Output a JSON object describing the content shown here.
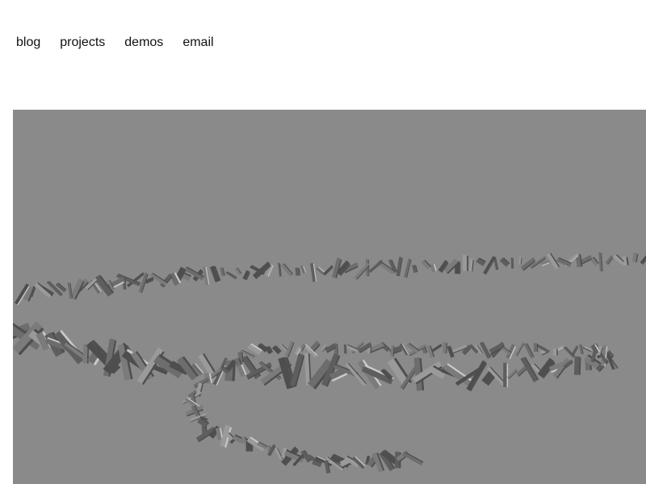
{
  "nav": {
    "items": [
      {
        "label": "blog"
      },
      {
        "label": "projects"
      },
      {
        "label": "demos"
      },
      {
        "label": "email"
      }
    ]
  },
  "scene": {
    "background_color": "#8a8a8a",
    "slab_colors": [
      "#5e5e5e",
      "#6d6d6d",
      "#7b7b7b",
      "#4e4e4e",
      "#9a9a9a",
      "#c8c8c8"
    ]
  }
}
